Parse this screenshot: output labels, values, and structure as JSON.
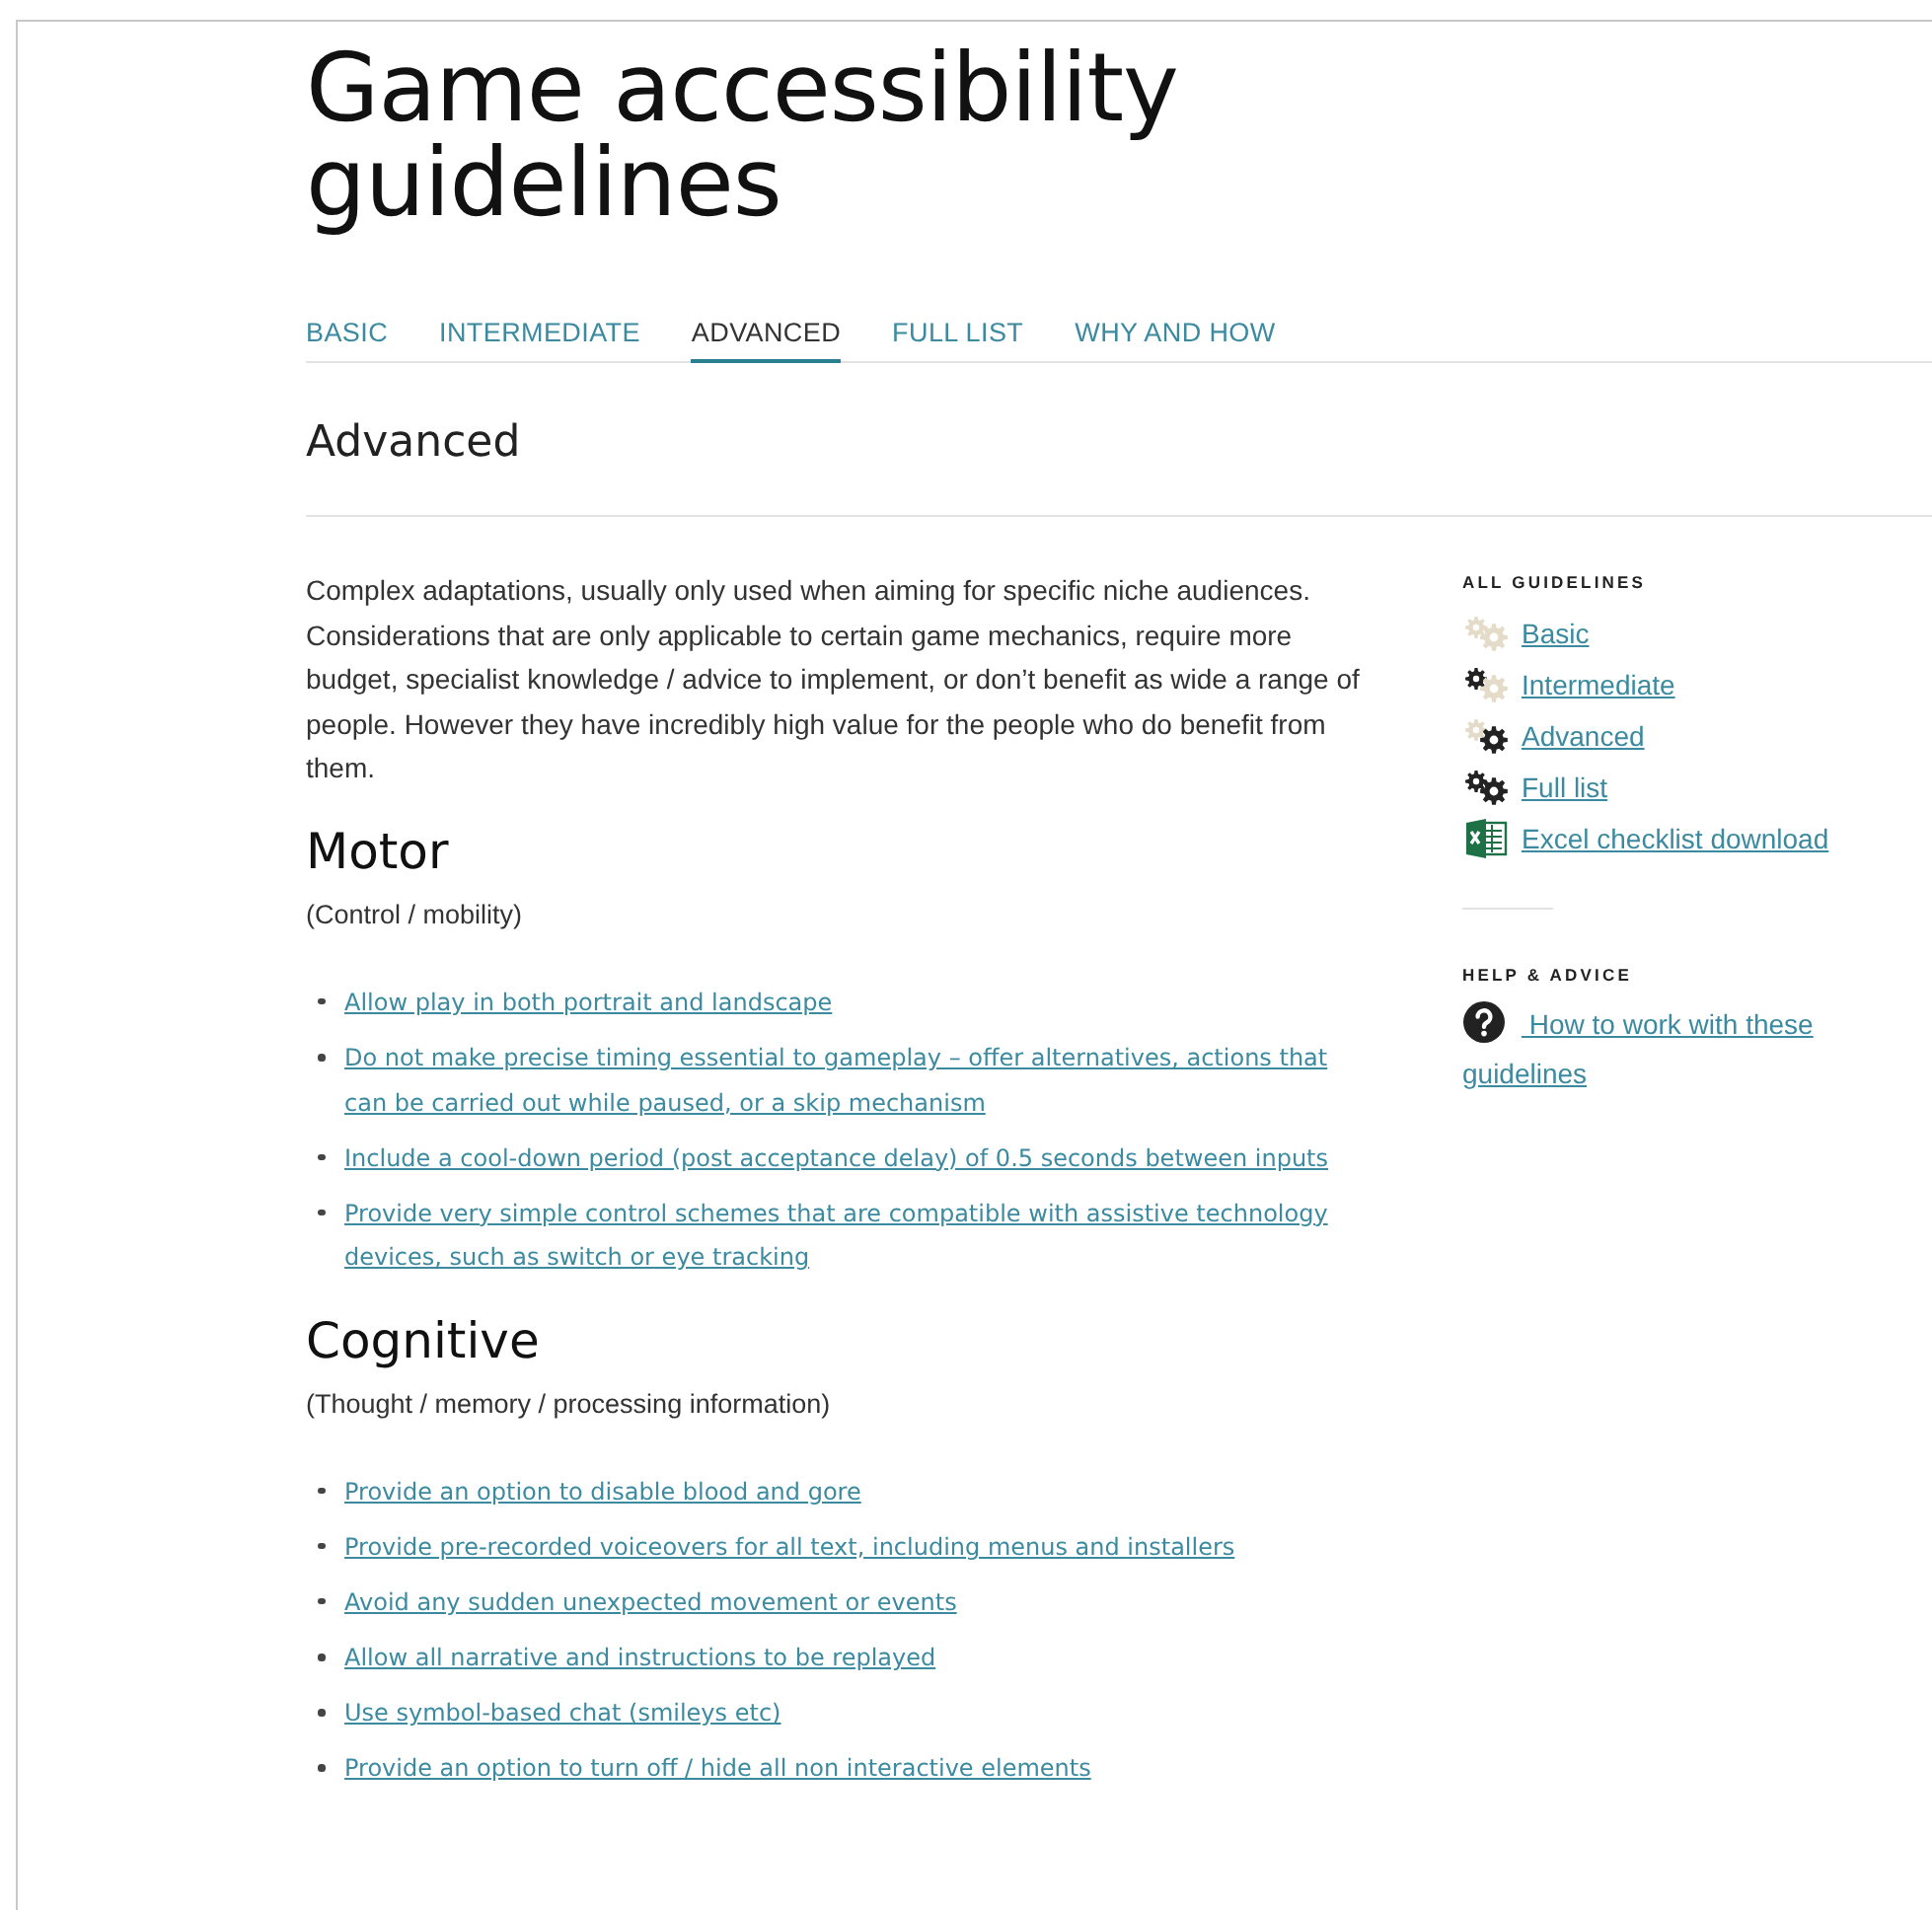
{
  "page_title": "Game accessibility guidelines",
  "tabs": [
    {
      "label": "BASIC",
      "selected": false
    },
    {
      "label": "INTERMEDIATE",
      "selected": false
    },
    {
      "label": "ADVANCED",
      "selected": true
    },
    {
      "label": "FULL LIST",
      "selected": false
    },
    {
      "label": "WHY AND HOW",
      "selected": false
    }
  ],
  "section_title": "Advanced",
  "intro": "Complex adaptations, usually only used when aiming for specific niche audiences. Considerations that are only applicable to certain game mechanics, require more budget, specialist knowledge / advice to implement, or don’t benefit as wide a range of people. However they have incredibly high value for the people who do benefit from them.",
  "categories": [
    {
      "title": "Motor",
      "subtitle": "(Control / mobility)",
      "guidelines": [
        "Allow play in both portrait and landscape",
        "Do not make precise timing essential to gameplay – offer alternatives, actions that can be carried out while paused, or a skip mechanism",
        "Include a cool-down period (post acceptance delay) of 0.5 seconds between inputs",
        "Provide very simple control schemes that are compatible with assistive technology devices, such as switch or eye tracking"
      ]
    },
    {
      "title": "Cognitive",
      "subtitle": "(Thought / memory / processing information)",
      "guidelines": [
        "Provide an option to disable blood and gore",
        " Provide pre-recorded voiceovers for all text, including menus and installers",
        "Avoid any sudden unexpected movement or events",
        "Allow all narrative and instructions to be replayed",
        "Use symbol-based chat (smileys etc)",
        "Provide an option to turn off / hide all non interactive elements"
      ]
    }
  ],
  "sidebar": {
    "all_heading": "ALL GUIDELINES",
    "links": [
      {
        "label": "Basic",
        "kind": "basic"
      },
      {
        "label": "Intermediate",
        "kind": "intermediate"
      },
      {
        "label": "Advanced",
        "kind": "advanced"
      },
      {
        "label": "Full list",
        "kind": "full"
      },
      {
        "label": "Excel checklist download",
        "kind": "excel"
      }
    ],
    "help_heading": "HELP & ADVICE",
    "help_link": "How to work with these guidelines"
  }
}
